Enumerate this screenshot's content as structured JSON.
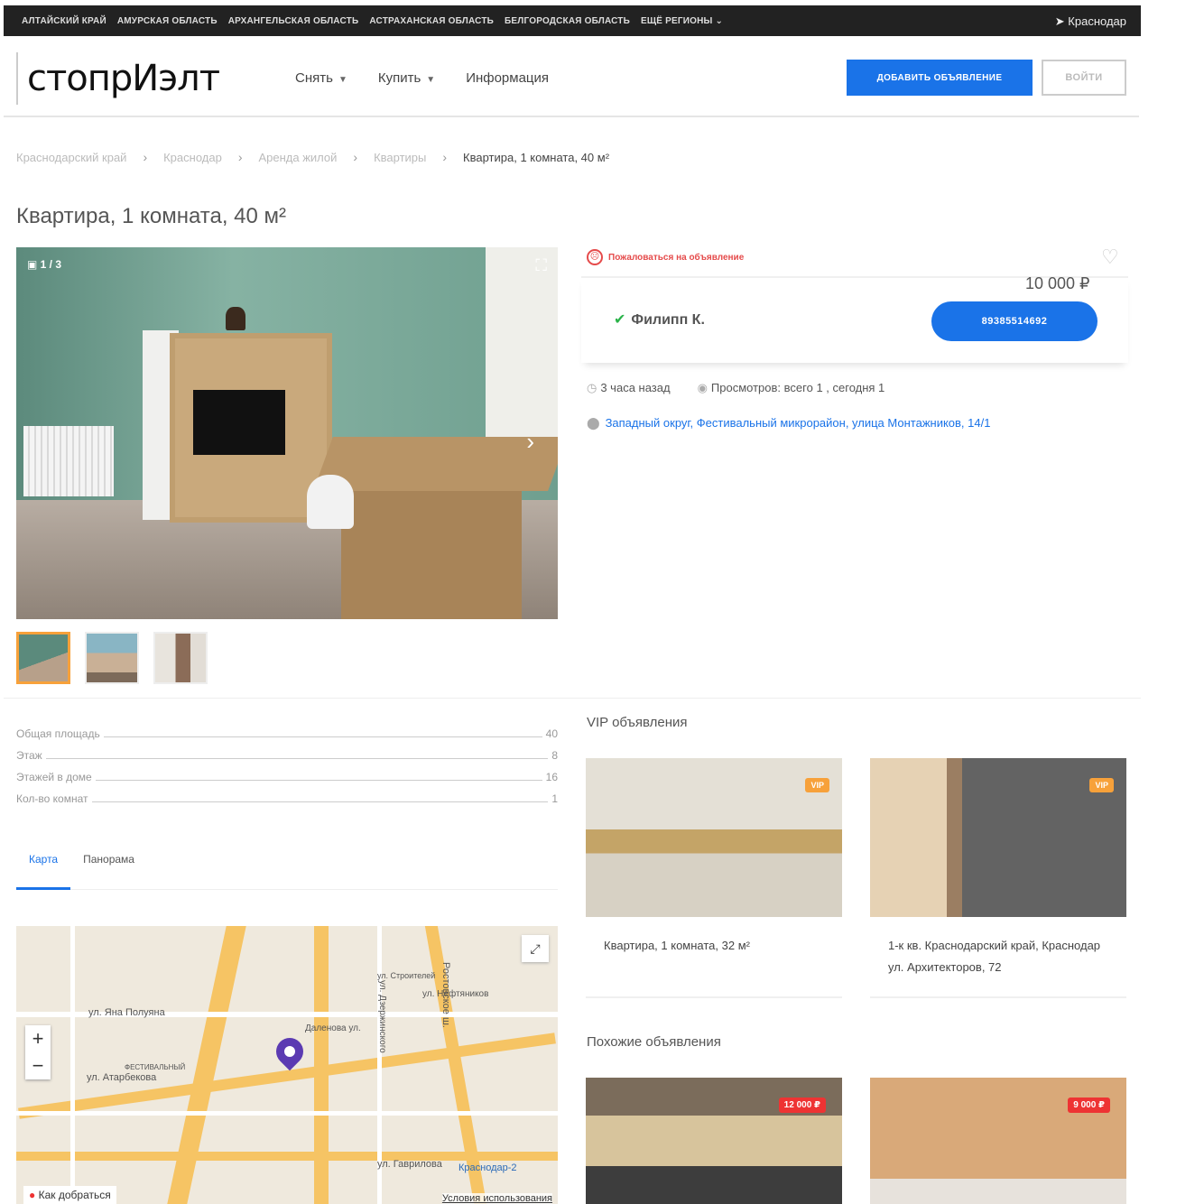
{
  "topbar": {
    "regions": [
      "АЛТАЙСКИЙ КРАЙ",
      "АМУРСКАЯ ОБЛАСТЬ",
      "АРХАНГЕЛЬСКАЯ ОБЛАСТЬ",
      "АСТРАХАНСКАЯ ОБЛАСТЬ",
      "БЕЛГОРОДСКАЯ ОБЛАСТЬ"
    ],
    "more": "ЕЩЁ РЕГИОНЫ ⌄",
    "city": "Краснодар"
  },
  "header": {
    "logo": "стопрИэлт",
    "nav": [
      {
        "label": "Снять"
      },
      {
        "label": "Купить"
      },
      {
        "label": "Информация"
      }
    ],
    "add_label": "ДОБАВИТЬ ОБЪЯВЛЕНИЕ",
    "login_label": "ВОЙТИ"
  },
  "breadcrumbs": [
    "Краснодарский край",
    "Краснодар",
    "Аренда жилой",
    "Квартиры",
    "Квартира, 1 комната, 40 м²"
  ],
  "listing": {
    "title": "Квартира, 1 комната, 40 м²",
    "photo_counter": "1 / 3",
    "complain": "Пожаловаться на объявление",
    "price": "10 000 ₽",
    "seller": "Филипп К.",
    "phone": "89385514692",
    "posted": "3 часа назад",
    "views": "Просмотров: всего 1 , сегодня 1",
    "address": "Западный округ, Фестивальный микрорайон, улица Монтажников, 14/1"
  },
  "params": [
    {
      "label": "Общая площадь",
      "value": "40"
    },
    {
      "label": "Этаж",
      "value": "8"
    },
    {
      "label": "Этажей в доме",
      "value": "16"
    },
    {
      "label": "Кол-во комнат",
      "value": "1"
    }
  ],
  "tabs": [
    "Карта",
    "Панорама"
  ],
  "map": {
    "labels": [
      "ул. Яна Полуяна",
      "ул. Атарбекова",
      "ФЕСТИВАЛЬНЫЙ",
      "Ростовское ш.",
      "ул. Дзержинского",
      "ул. Гаврилова",
      "Краснодар-2",
      "Даленова ул.",
      "ул. Нефтяников",
      "ул. Строителей"
    ],
    "howto": "Как добраться",
    "terms": "Условия использования"
  },
  "vip": {
    "heading": "VIP объявления",
    "badge": "VIP",
    "cards": [
      "Квартира, 1 комната, 32 м²",
      "1-к кв. Краснодарский край, Краснодар ул. Архитекторов, 72"
    ]
  },
  "similar": {
    "heading": "Похожие объявления",
    "prices": [
      "12 000 ₽",
      "9 000 ₽"
    ]
  },
  "colors": {
    "accent": "#1a73e8",
    "vip": "#f7a13a",
    "danger": "#e33"
  }
}
